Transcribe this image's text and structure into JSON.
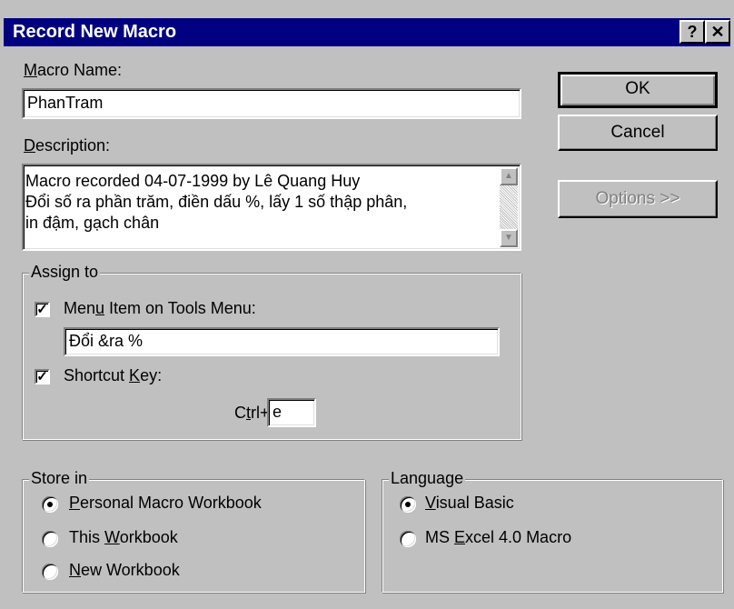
{
  "window": {
    "title": "Record New Macro",
    "help_btn": "?",
    "close_btn": "✕"
  },
  "macro_name": {
    "label_pre": "",
    "label_u": "M",
    "label_post": "acro Name:",
    "value": "PhanTram"
  },
  "description": {
    "label_u": "D",
    "label_post": "escription:",
    "lines": [
      "Macro recorded 04-07-1999 by Lê Quang Huy",
      "Đổi số ra phần trăm, điền dấu %, lấy 1 số thập phân,",
      "in đậm, gạch chân"
    ]
  },
  "buttons": {
    "ok": "OK",
    "cancel": "Cancel",
    "options": "Options >>"
  },
  "assign_to": {
    "legend": "Assign to",
    "menu_item": {
      "label_pre": "Men",
      "label_u": "u",
      "label_post": " Item on Tools Menu:",
      "checked": true,
      "value": "Đổi &ra %"
    },
    "shortcut": {
      "label_pre": "Shortcut ",
      "label_u": "K",
      "label_post": "ey:",
      "checked": true,
      "ctrl_pre": "C",
      "ctrl_u": "t",
      "ctrl_post": "rl+",
      "value": "e"
    }
  },
  "store_in": {
    "legend": "Store in",
    "options": [
      {
        "u": "P",
        "rest": "ersonal Macro Workbook",
        "pre": "",
        "selected": true
      },
      {
        "pre": "This ",
        "u": "W",
        "rest": "orkbook",
        "selected": false
      },
      {
        "pre": "",
        "u": "N",
        "rest": "ew Workbook",
        "selected": false
      }
    ]
  },
  "language": {
    "legend": "Language",
    "options": [
      {
        "pre": "",
        "u": "V",
        "rest": "isual Basic",
        "selected": true
      },
      {
        "pre": "MS ",
        "u": "E",
        "rest": "xcel 4.0 Macro",
        "selected": false
      }
    ]
  }
}
